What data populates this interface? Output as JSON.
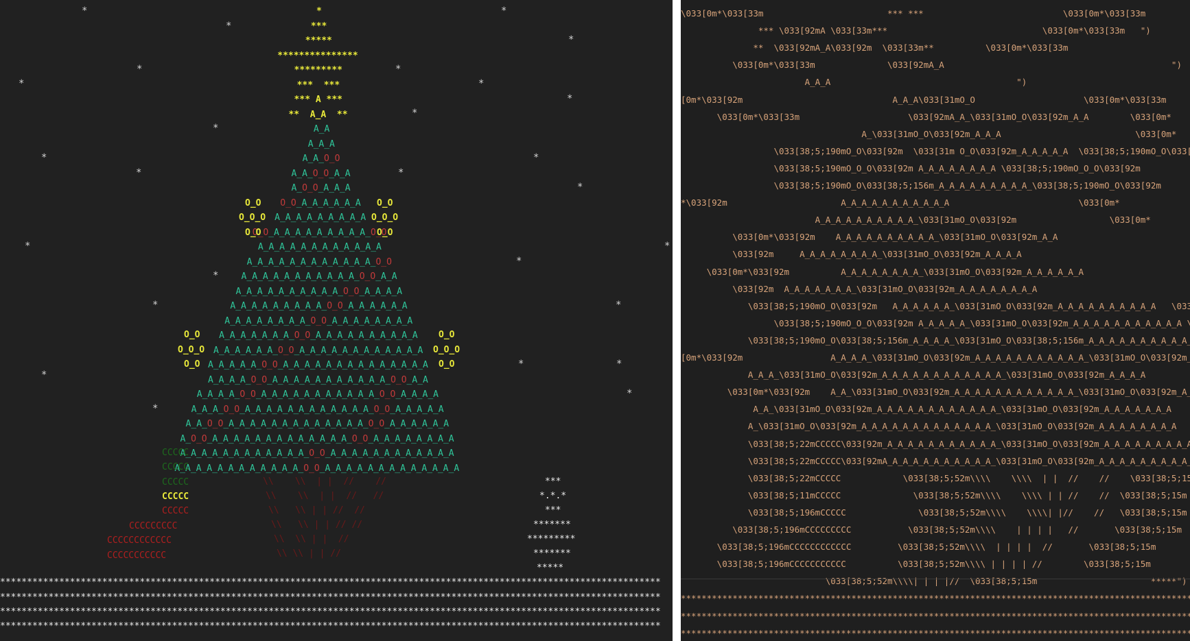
{
  "colors": {
    "background": "#212121",
    "divider": "#ffffff",
    "code_text": "#d7a37a",
    "tree_green": "#2fc59a",
    "ornament_yellow": "#e8e83a",
    "ornament_red": "#c23a3a"
  },
  "left": {
    "snow": "*",
    "tree": {
      "star": [
        "*",
        "***",
        "*****",
        "***************",
        "*********",
        "***  ***",
        "*** A ***",
        "**  A_A  **"
      ],
      "rows": [
        "A_A",
        "A_A_A",
        "A_A_O_O",
        "A_A_O_O_A_A",
        "A_O_O_A_A_A",
        "O_O_A_A_A_A_A_A",
        "A_A_A_A_A_A_A_A_A",
        "O_O_A_A_A_A_A_A_A_A_A_O_O",
        "A_A_A_A_A_A_A_A_A_A_A_A",
        "A_A_A_A_A_A_A_A_A_A_A_A_O_O",
        "A_A_A_A_A_A_A_A_A_A_A_O_O_A_A",
        "A_A_A_A_A_A_A_A_A_A_O_O_A_A_A_A",
        "A_A_A_A_A_A_A_A_A_O_O_A_A_A_A_A_A",
        "A_A_A_A_A_A_A_A_O_O_A_A_A_A_A_A_A_A",
        "A_A_A_A_A_A_A_O_O_A_A_A_A_A_A_A_A_A_A",
        "A_A_A_A_A_A_O_O_A_A_A_A_A_A_A_A_A_A_A_A",
        "A_A_A_A_A_O_O_A_A_A_A_A_A_A_A_A_A_A_A_A_A",
        "A_A_A_A_O_O_A_A_A_A_A_A_A_A_A_A_A_O_O_A_A",
        "A_A_A_A_O_O_A_A_A_A_A_A_A_A_A_A_A_O_O_A_A_A_A",
        "A_A_A_O_O_A_A_A_A_A_A_A_A_A_A_A_A_O_O_A_A_A_A_A",
        "A_A_O_O_A_A_A_A_A_A_A_A_A_A_A_A_A_O_O_A_A_A_A_A_A",
        "A_O_O_A_A_A_A_A_A_A_A_A_A_A_A_A_O_O_A_A_A_A_A_A_A_A",
        "A_A_A_A_A_A_A_A_A_A_A_A_O_O_A_A_A_A_A_A_A_A_A_A_A_A",
        "A_A_A_A_A_A_A_A_A_A_A_A_O_O_A_A_A_A_A_A_A_A_A_A_A_A_A"
      ],
      "ornament_a": "O_O",
      "ornament_b": "O_O_O",
      "trunk": [
        "\\\\    \\\\  | |  //    //",
        "\\\\    \\\\  | |  //   //",
        "\\\\   \\\\ | | //  //",
        "\\\\   \\\\ | | // //",
        "\\\\  \\\\ | |  //",
        "\\\\ \\\\ | | //"
      ],
      "pot": [
        "CCCCC",
        "CCCCC",
        "CCCCC",
        "CCCCC",
        "CCCCC",
        "CCCCCCCCC",
        "CCCCCCCCCCCC",
        "CCCCCCCCCCC"
      ],
      "snowman": [
        "***",
        "*.*.*",
        "***",
        "*******",
        "*********",
        "*******",
        "*****"
      ],
      "ground": "***************************************************************************************************************************"
    }
  },
  "right": {
    "lines": [
      "\\033[0m*\\033[33m                        *** ***                           \\033[0m*\\033[33m",
      "               *** \\033[92mA \\033[33m***                              \\033[0m*\\033[33m   \")",
      "              **  \\033[92mA_A\\033[92m  \\033[33m**          \\033[0m*\\033[33m",
      "          \\033[0m*\\033[33m              \\033[92mA_A                                            \")",
      "                        A_A_A                                    \")",
      "[0m*\\033[92m                             A_A_A\\033[31mO_O                     \\033[0m*\\033[33m",
      "       \\033[0m*\\033[33m                     \\033[92mA_A_\\033[31mO_O\\033[92m_A_A        \\033[0m*",
      "                                   A_\\033[31mO_O\\033[92m_A_A_A                          \\033[0m*",
      "                  \\033[38;5;190mO_O\\033[92m  \\033[31m O_O\\033[92m_A_A_A_A_A  \\033[38;5;190mO_O\\033[92m",
      "                  \\033[38;5;190mO_O_O\\033[92m A_A_A_A_A_A_A_A \\033[38;5;190mO_O_O\\033[92m",
      "                  \\033[38;5;190mO_O\\033[38;5;156m_A_A_A_A_A_A_A_A_A_\\033[38;5;190mO_O\\033[92m",
      "*\\033[92m                      A_A_A_A_A_A_A_A_A_A_A                         \\033[0m*",
      "                          A_A_A_A_A_A_A_A_A_A_\\033[31mO_O\\033[92m                  \\033[0m*",
      "          \\033[0m*\\033[92m    A_A_A_A_A_A_A_A_A_A_\\033[31mO_O\\033[92m_A_A",
      "          \\033[92m     A_A_A_A_A_A_A_A_\\033[31mO_O\\033[92m_A_A_A_A                                 \")",
      "     \\033[0m*\\033[92m          A_A_A_A_A_A_A_A_\\033[31mO_O\\033[92m_A_A_A_A_A_A",
      "          \\033[92m  A_A_A_A_A_A_A_\\033[31mO_O\\033[92m_A_A_A_A_A_A_A_A",
      "             \\033[38;5;190mO_O\\033[92m   A_A_A_A_A_A_\\033[31mO_O\\033[92m_A_A_A_A_A_A_A_A_A_A   \\033[38;5;190mO_O\\033[92m",
      "                  \\033[38;5;190mO_O_O\\033[92m A_A_A_A_A_\\033[31mO_O\\033[92m_A_A_A_A_A_A_A_A_A_A_A \\033[38;5;190mO_O_O",
      "             \\033[38;5;190mO_O\\033[38;5;156m_A_A_A_A_\\033[31mO_O\\033[38;5;156m_A_A_A_A_A_A_A_A_A_A_A_A_\\033[31mO_O\\033[38;5;190m_O_O",
      "[0m*\\033[92m                 A_A_A_A_\\033[31mO_O\\033[92m_A_A_A_A_A_A_A_A_A_A_A_\\033[31mO_O\\033[92m_A_A",
      "             A_A_A_\\033[31mO_O\\033[92m_A_A_A_A_A_A_A_A_A_A_A_A_\\033[31mO_O\\033[92m_A_A_A_A",
      "         \\033[0m*\\033[92m    A_A_\\033[31mO_O\\033[92m_A_A_A_A_A_A_A_A_A_A_A_A_\\033[31mO_O\\033[92m_A_A_A_A_A_A",
      "              A_A_\\033[31mO_O\\033[92m_A_A_A_A_A_A_A_A_A_A_A_A_\\033[31mO_O\\033[92m_A_A_A_A_A_A_A",
      "             A_\\033[31mO_O\\033[92m_A_A_A_A_A_A_A_A_A_A_A_A_A_\\033[31mO_O\\033[92m_A_A_A_A_A_A_A_A",
      "             \\033[38;5;22mCCCCC\\033[92m_A_A_A_A_A_A_A_A_A_A_A_\\033[31mO_O\\033[92m_A_A_A_A_A_A_A_A_A_A_A",
      "             \\033[38;5;22mCCCCC\\033[92mA_A_A_A_A_A_A_A_A_A_A_\\033[31mO_O\\033[92m_A_A_A_A_A_A_A_A_A_A_A_A",
      "             \\033[38;5;22mCCCCC            \\033[38;5;52m\\\\\\\\    \\\\\\\\  | |  //    //    \\033[38;5;15m                 ***",
      "             \\033[38;5;11mCCCCC              \\033[38;5;52m\\\\\\\\    \\\\\\\\ | | //    //  \\033[38;5;15m                *\\033[3",
      "             \\033[38;5;196mCCCCC              \\033[38;5;52m\\\\\\\\    \\\\\\\\| |//    //   \\033[38;5;15m                \\033[38;5",
      "          \\033[38;5;196mCCCCCCCCC           \\033[38;5;52m\\\\\\\\    | | | |   //       \\033[38;5;15m              \\033[38;5",
      "       \\033[38;5;196mCCCCCCCCCCCC         \\033[38;5;52m\\\\\\\\  | | | |  //       \\033[38;5;15m              *********",
      "       \\033[38;5;196mCCCCCCCCCCC          \\033[38;5;52m\\\\\\\\ | | | | //        \\033[38;5;15m              *******",
      "                            \\033[38;5;52m\\\\\\\\| | | |//  \\033[38;5;15m                      *****\")",
      "****************************************************************************************************************************",
      "****************************************************************************************************************************\")",
      "****************************************************************************************************************************"
    ]
  }
}
